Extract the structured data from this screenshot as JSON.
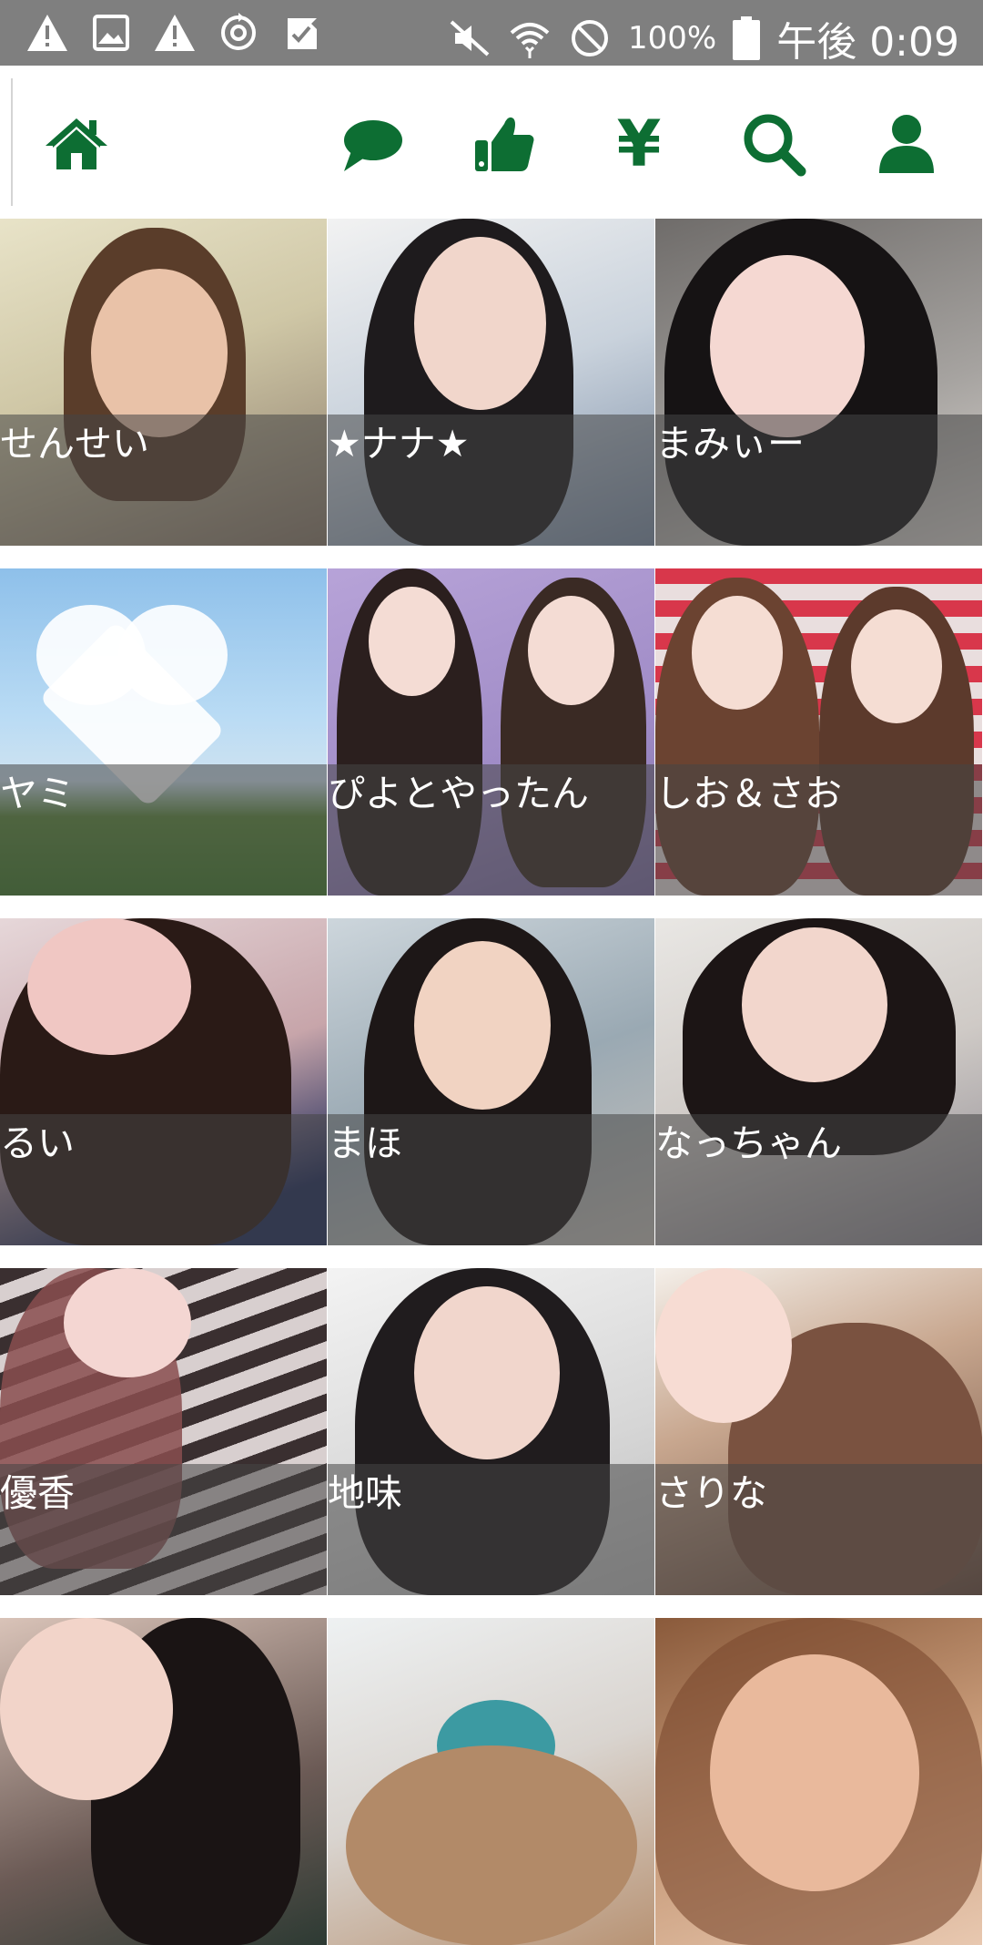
{
  "status_bar": {
    "left_icons": [
      "warning-icon",
      "image-icon",
      "warning-icon",
      "sync-icon",
      "check-flag-icon"
    ],
    "right_icons": [
      "mute-icon",
      "wifi-icon",
      "no-sim-icon",
      "battery-icon"
    ],
    "battery_percent": "100%",
    "time": "午後 0:09"
  },
  "nav": {
    "items": [
      {
        "icon": "home-icon",
        "color": "#0d6e33"
      },
      {
        "icon": "chat-icon",
        "color": "#0d6e33"
      },
      {
        "icon": "thumbs-up-icon",
        "color": "#0d6e33"
      },
      {
        "icon": "yen-icon",
        "label": "¥",
        "color": "#0d6e33"
      },
      {
        "icon": "search-icon",
        "color": "#0d6e33"
      },
      {
        "icon": "user-icon",
        "color": "#0d6e33"
      }
    ]
  },
  "profiles": [
    {
      "name": "せんせい"
    },
    {
      "name": "★ナナ★"
    },
    {
      "name": "まみぃー"
    },
    {
      "name": "ヤミ"
    },
    {
      "name": "ぴよとやったん"
    },
    {
      "name": "しお＆さお"
    },
    {
      "name": "るい"
    },
    {
      "name": "まほ"
    },
    {
      "name": "なっちゃん"
    },
    {
      "name": "優香"
    },
    {
      "name": "地味"
    },
    {
      "name": "さりな"
    },
    {
      "name": ""
    },
    {
      "name": ""
    },
    {
      "name": ""
    }
  ]
}
